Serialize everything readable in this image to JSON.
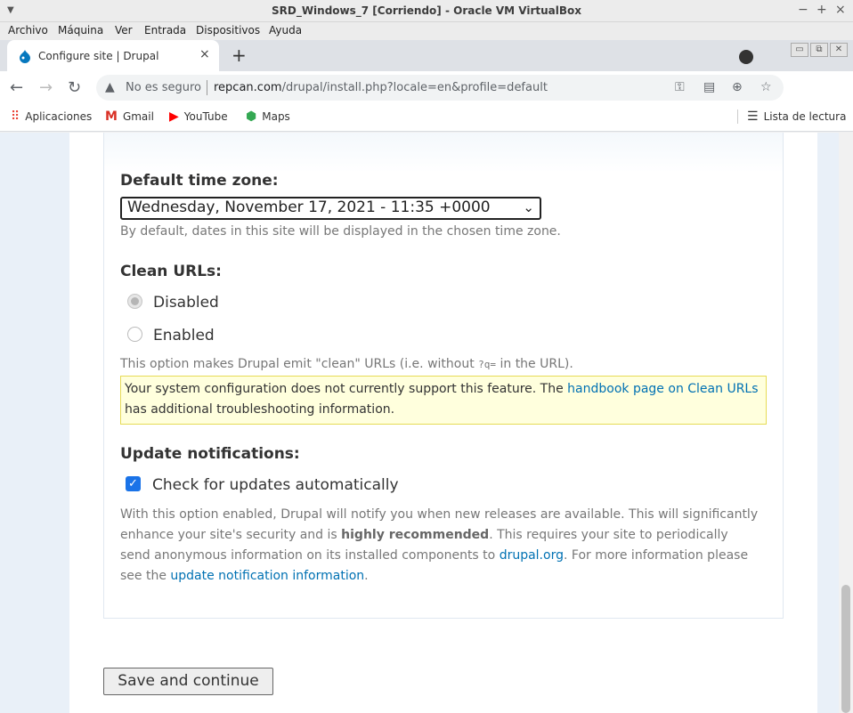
{
  "vbox": {
    "title": "SRD_Windows_7 [Corriendo] - Oracle VM VirtualBox",
    "menu": [
      "Archivo",
      "Máquina",
      "Ver",
      "Entrada",
      "Dispositivos",
      "Ayuda"
    ],
    "controls": [
      "−",
      "+",
      "×"
    ]
  },
  "browser": {
    "tab_title": "Configure site | Drupal",
    "tab_close": "×",
    "new_tab": "+",
    "insecure_label": "No es seguro",
    "url_host": "repcan.com",
    "url_path": "/drupal/install.php?locale=en&profile=default",
    "bookmarks": [
      "Aplicaciones",
      "Gmail",
      "YouTube",
      "Maps"
    ],
    "reading_list": "Lista de lectura"
  },
  "form": {
    "timezone": {
      "label": "Default time zone:",
      "value": "Wednesday, November 17, 2021 - 11:35 +0000",
      "description": "By default, dates in this site will be displayed in the chosen time zone."
    },
    "clean_urls": {
      "label": "Clean URLs:",
      "options": [
        "Disabled",
        "Enabled"
      ],
      "selected": "Disabled",
      "description_pre": "This option makes Drupal emit \"clean\" URLs (i.e. without ",
      "description_code": "?q=",
      "description_post": " in the URL).",
      "note_pre": "Your system configuration does not currently support this feature. The ",
      "note_link": "handbook page on Clean URLs",
      "note_post": " has additional troubleshooting information."
    },
    "updates": {
      "label": "Update notifications:",
      "checkbox_label": "Check for updates automatically",
      "checked": true,
      "desc_1": "With this option enabled, Drupal will notify you when new releases are available. This will significantly enhance your site's security and is ",
      "desc_bold": "highly recommended",
      "desc_2": ". This requires your site to periodically send anonymous information on its installed components to ",
      "desc_link1": "drupal.org",
      "desc_3": ". For more information please see the ",
      "desc_link2": "update notification information",
      "desc_4": "."
    },
    "submit": "Save and continue"
  }
}
